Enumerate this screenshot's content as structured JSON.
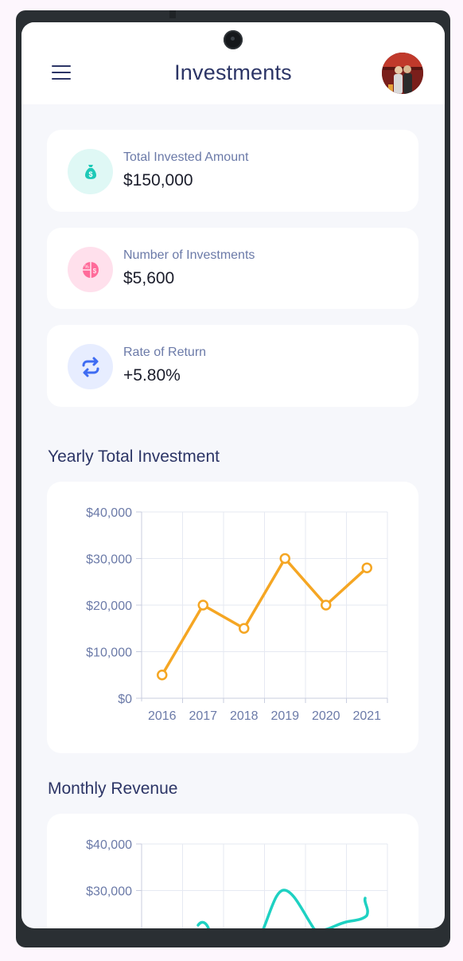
{
  "header": {
    "title": "Investments",
    "menu_icon": "menu-icon",
    "avatar": "user-avatar"
  },
  "stats": [
    {
      "label": "Total Invested Amount",
      "value": "$150,000",
      "icon": "money-bag-icon",
      "icon_bg": "#dff8f5",
      "icon_color": "#1dc9b7"
    },
    {
      "label": "Number of Investments",
      "value": "$5,600",
      "icon": "pie-chart-money-icon",
      "icon_bg": "#ffe0ec",
      "icon_color": "#ff6b9a"
    },
    {
      "label": "Rate of Return",
      "value": "+5.80%",
      "icon": "repeat-arrows-icon",
      "icon_bg": "#e7edff",
      "icon_color": "#3f6cf2"
    }
  ],
  "yearly": {
    "section_title": "Yearly Total Investment",
    "chart_data": {
      "type": "line",
      "categories": [
        "2016",
        "2017",
        "2018",
        "2019",
        "2020",
        "2021"
      ],
      "values": [
        5000,
        20000,
        15000,
        30000,
        20000,
        28000
      ],
      "ylim": [
        0,
        40000
      ],
      "yticks": [
        "$0",
        "$10,000",
        "$20,000",
        "$30,000",
        "$40,000"
      ],
      "color": "#f5a623",
      "grid": true
    }
  },
  "monthly": {
    "section_title": "Monthly Revenue",
    "chart_data": {
      "type": "line",
      "ylim": [
        0,
        40000
      ],
      "yticks": [
        "$30,000",
        "$40,000"
      ],
      "color": "#1ed1c2",
      "grid": true
    }
  }
}
